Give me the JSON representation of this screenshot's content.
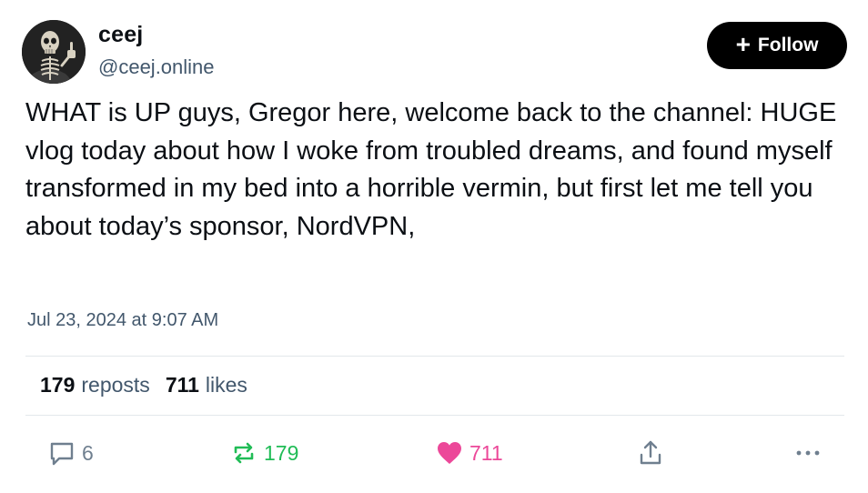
{
  "author": {
    "display_name": "ceej",
    "handle": "@ceej.online",
    "avatar_icon": "skeleton-thumbs-up-avatar"
  },
  "follow_button": {
    "icon": "plus-icon",
    "label": "Follow"
  },
  "post": {
    "text": "WHAT is UP guys, Gregor here, welcome back to the channel: HUGE vlog today about how I woke from troubled dreams, and found myself transformed in my bed into a horrible vermin, but first let me tell you about today’s sponsor, NordVPN,",
    "timestamp": "Jul 23, 2024 at 9:07 AM"
  },
  "stats": {
    "reposts_count": "179",
    "reposts_label": "reposts",
    "likes_count": "711",
    "likes_label": "likes"
  },
  "actions": {
    "reply": {
      "icon": "reply-bubble-icon",
      "count": "6",
      "color": "#6f7f8f"
    },
    "repost": {
      "icon": "repost-icon",
      "count": "179",
      "color": "#20bc56"
    },
    "like": {
      "icon": "heart-icon",
      "count": "711",
      "color": "#ec4899"
    },
    "share": {
      "icon": "share-icon"
    },
    "more": {
      "icon": "more-dots-icon"
    }
  },
  "colors": {
    "text_primary": "#0b0f14",
    "text_secondary": "#42576c",
    "divider": "#e3e7eb",
    "follow_bg": "#000000"
  }
}
